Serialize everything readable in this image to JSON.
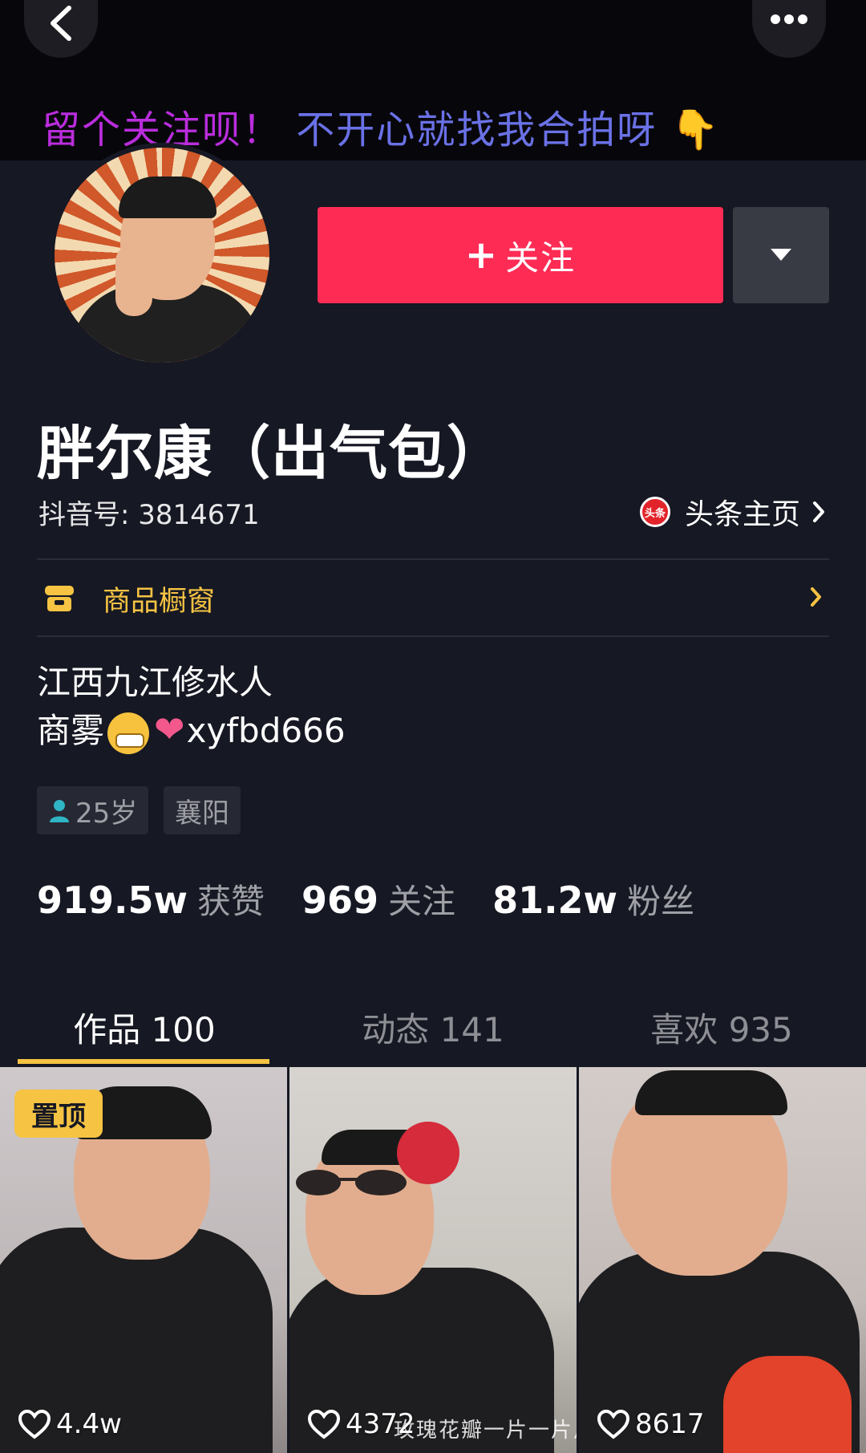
{
  "header": {
    "banner_part1": "留个关注呗！",
    "banner_part2": "不开心就找我合拍呀",
    "banner_emoji": "👇"
  },
  "profile": {
    "follow_label": "关注",
    "follow_plus": "+",
    "display_name": "胖尔康（出气包）",
    "douyin_id": "抖音号: 3814671",
    "toutiao_logo_text": "头条",
    "toutiao_link": "头条主页",
    "shop_label": "商品橱窗",
    "bio_line1": "江西九江修水人",
    "bio_line2_prefix": "商雾",
    "bio_line2_heart": "❤",
    "bio_line2_suffix": "xyfbd666",
    "tag_age": "25岁",
    "tag_location": "襄阳"
  },
  "stats": [
    {
      "num": "919.5w",
      "label": "获赞"
    },
    {
      "num": "969",
      "label": "关注"
    },
    {
      "num": "81.2w",
      "label": "粉丝"
    }
  ],
  "tabs": [
    {
      "label": "作品 100"
    },
    {
      "label": "动态 141"
    },
    {
      "label": "喜欢 935"
    }
  ],
  "videos": [
    {
      "pin": "置顶",
      "likes": "4.4w"
    },
    {
      "likes": "4372",
      "subtitle": "玫瑰花瓣一片一片片~"
    },
    {
      "likes": "8617"
    }
  ],
  "colors": {
    "background": "#161823",
    "follow_button": "#fe2c55",
    "accent_yellow": "#f6c343"
  }
}
